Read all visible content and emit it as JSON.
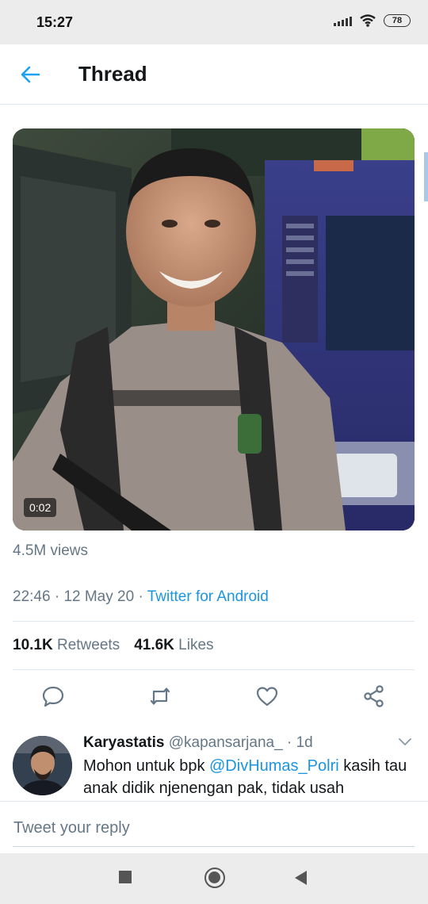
{
  "status_bar": {
    "time": "15:27",
    "battery": "78"
  },
  "header": {
    "title": "Thread"
  },
  "tweet": {
    "video_duration": "0:02",
    "views": "4.5M views",
    "time": "22:46",
    "date": "12 May 20",
    "client": "Twitter for Android",
    "retweets_count": "10.1K",
    "retweets_label": "Retweets",
    "likes_count": "41.6K",
    "likes_label": "Likes"
  },
  "actions": [
    "reply-icon",
    "retweet-icon",
    "like-icon",
    "share-icon"
  ],
  "reply": {
    "name": "Karyastatis",
    "handle": "@kapansarjana_",
    "age": "1d",
    "text_before": "Mohon untuk bpk ",
    "mention": "@DivHumas_Polri",
    "text_after": " kasih tau anak didik njenengan pak, tidak usah"
  },
  "composer": {
    "placeholder": "Tweet your reply"
  },
  "colors": {
    "accent": "#1b95e0",
    "secondary_text": "#657786"
  }
}
